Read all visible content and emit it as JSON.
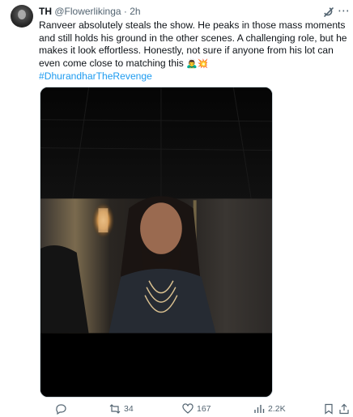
{
  "post": {
    "display_name": "TH",
    "handle": "@Flowerlikinga",
    "separator": "·",
    "time": "2h",
    "text": "Ranveer absolutely steals the show. He peaks in those mass moments and still holds his ground in the other scenes. A challenging role, but he makes it look effortless. Honestly, not sure if anyone from his lot can even come close to matching this",
    "emojis": "🙇‍♂️💥",
    "hashtag": "#DhurandharTheRevenge"
  },
  "actions": {
    "reply_count": "",
    "repost_count": "34",
    "like_count": "167",
    "views_count": "2.2K"
  },
  "colors": {
    "link": "#1d9bf0",
    "muted": "#536471",
    "text": "#0f1419"
  },
  "icons": [
    "grok-icon",
    "more-icon",
    "reply-icon",
    "repost-icon",
    "like-icon",
    "views-icon",
    "bookmark-icon",
    "share-icon"
  ]
}
